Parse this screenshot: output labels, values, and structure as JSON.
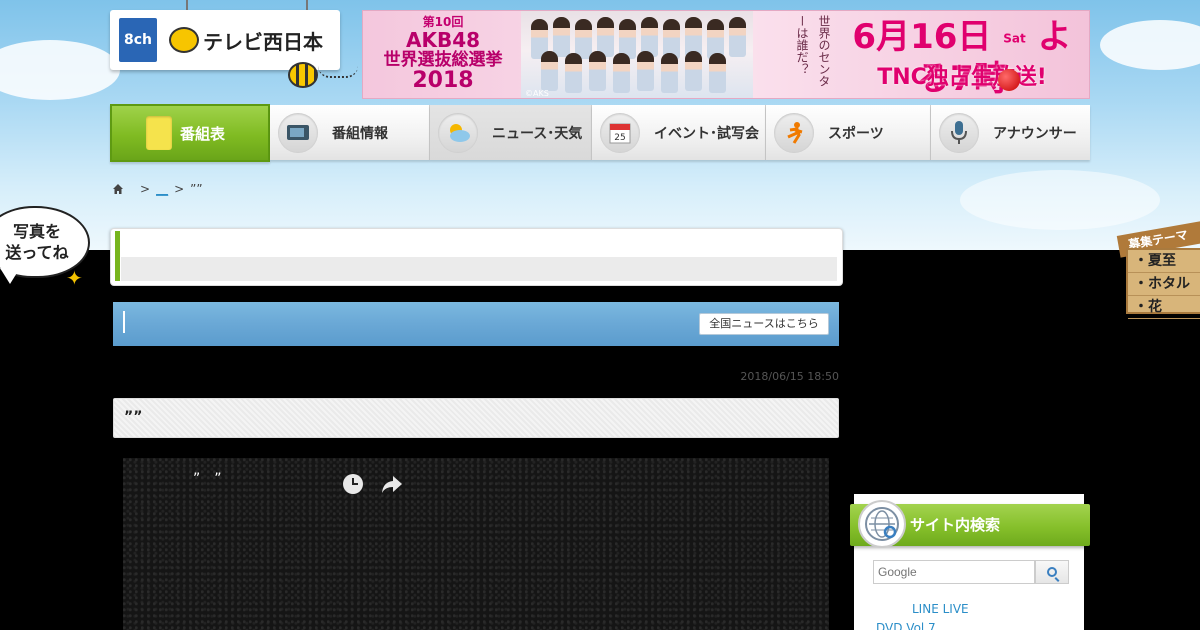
{
  "logo": {
    "channel": "8ch",
    "name": "テレビ西日本"
  },
  "banner": {
    "edition": "第10回",
    "line1": "AKB48",
    "line2": "世界選抜総選挙",
    "year": "2018",
    "credit": "©AKS",
    "question": "世界のセンターは誰だ？",
    "date": "6月16日",
    "weekday": "Sat",
    "time": "よる7時",
    "sub": "TNC独占生放送!"
  },
  "nav": {
    "items": [
      {
        "label": "番組表"
      },
      {
        "label": "番組情報"
      },
      {
        "label": "ニュース･天気"
      },
      {
        "label": "イベント･試写会"
      },
      {
        "label": "スポーツ"
      },
      {
        "label": "アナウンサー"
      }
    ],
    "calendar_day": "25"
  },
  "breadcrumb": {
    "sep1": ">",
    "link": "__",
    "sep2": ">",
    "current": "””"
  },
  "bubble": {
    "line1": "写真を",
    "line2": "送ってね"
  },
  "sign": {
    "title": "募集テーマ",
    "items": [
      "・夏至",
      "・ホタル",
      "・花"
    ]
  },
  "news_bar": {
    "button_label": "全国ニュースはこちら"
  },
  "article": {
    "timestamp": "2018/06/15 18:50",
    "headline": "””",
    "video_title": "”　”"
  },
  "sidebar": {
    "search_title": "サイト内検索",
    "search_placeholder": "Google",
    "link1": "LINE LIVE",
    "link2": "DVD Vol.7"
  },
  "colors": {
    "nav_active": "#80bb22",
    "news_bar": "#6aa8d6",
    "link": "#2b8ec8",
    "banner_accent": "#e0006e"
  }
}
